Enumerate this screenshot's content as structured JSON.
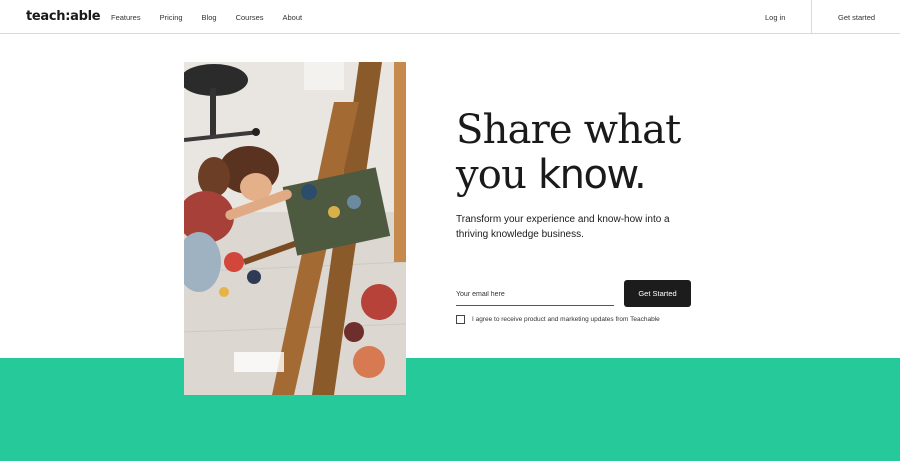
{
  "nav": {
    "logo": "teach:able",
    "links": [
      "Features",
      "Pricing",
      "Blog",
      "Courses",
      "About"
    ],
    "login": "Log in",
    "get_started": "Get started"
  },
  "hero": {
    "headline_part1": "Share what",
    "headline_part2": "you ",
    "headline_emph": "know.",
    "subtext": "Transform your experience and know-how into a thriving knowledge business.",
    "image_alt": "Artist painting at an easel"
  },
  "form": {
    "email_placeholder": "Your email here",
    "email_value": "",
    "cta_label": "Get Started",
    "consent_label": "I agree to receive product and marketing updates from Teachable",
    "consent_checked": false
  },
  "colors": {
    "accent_green": "#26c99a",
    "button_dark": "#1c1c1c"
  }
}
